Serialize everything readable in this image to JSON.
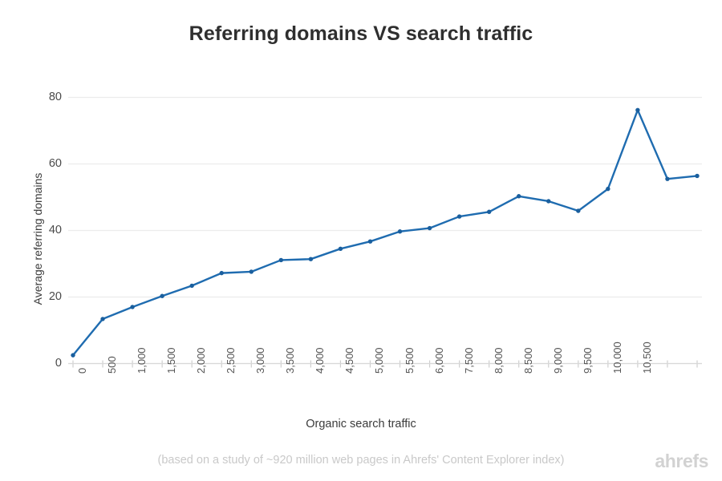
{
  "chart_data": {
    "type": "line",
    "title": "Referring domains VS search traffic",
    "xlabel": "Organic search traffic",
    "ylabel": "Average referring domains",
    "categories": [
      "0",
      "500",
      "1,000",
      "1,500",
      "2,000",
      "2,500",
      "3,000",
      "3,500",
      "4,000",
      "4,500",
      "5,000",
      "5,500",
      "6,000",
      "7,500",
      "8,000",
      "8,500",
      "9,000",
      "9,500",
      "10,000",
      "10,500"
    ],
    "values": [
      2.5,
      13.4,
      17.0,
      20.3,
      23.4,
      27.2,
      27.6,
      31.1,
      31.4,
      34.5,
      36.7,
      39.7,
      40.7,
      44.2,
      45.6,
      50.3,
      48.8,
      45.9,
      52.5,
      76.2
    ],
    "extra_values": [
      55.5,
      56.4
    ],
    "series": [
      {
        "name": "Average referring domains",
        "values": [
          2.5,
          13.4,
          17.0,
          20.3,
          23.4,
          27.2,
          27.6,
          31.1,
          31.4,
          34.5,
          36.7,
          39.7,
          40.7,
          44.2,
          45.6,
          50.3,
          48.8,
          45.9,
          52.5,
          76.2,
          55.5,
          56.4
        ]
      }
    ],
    "x_tick_labels": [
      "0",
      "500",
      "1,000",
      "1,500",
      "2,000",
      "2,500",
      "3,000",
      "3,500",
      "4,000",
      "4,500",
      "5,000",
      "5,500",
      "6,000",
      "7,500",
      "8,000",
      "8,500",
      "9,000",
      "9,500",
      "10,000",
      "10,500"
    ],
    "y_tick_labels": [
      "0",
      "20",
      "40",
      "60",
      "80"
    ],
    "y_ticks": [
      0,
      20,
      40,
      60,
      80
    ],
    "ylim": [
      0,
      84
    ],
    "grid": "horizontal",
    "legend": "none",
    "line_color": "#1f6cb0",
    "marker_color": "#1a5f9e",
    "grid_color": "#ececec"
  },
  "footer": {
    "note": "(based on a study of ~920 million web pages in Ahrefs' Content Explorer index)",
    "logo": "ahrefs"
  }
}
